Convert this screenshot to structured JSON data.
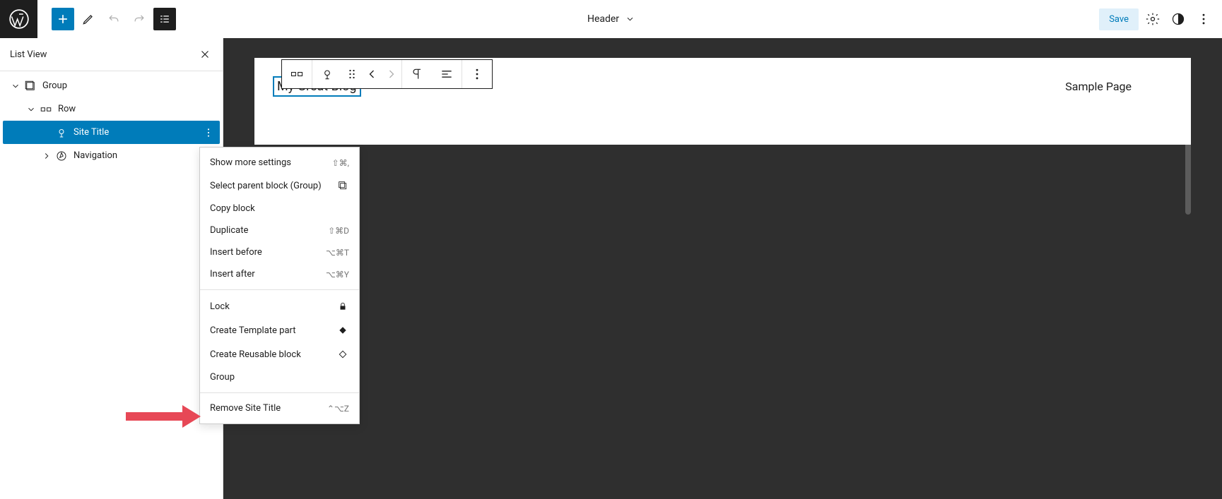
{
  "topbar": {
    "template_label": "Header",
    "save_label": "Save"
  },
  "list_view": {
    "title": "List View",
    "items": [
      {
        "label": "Group",
        "depth": 0,
        "expanded": true,
        "icon": "group"
      },
      {
        "label": "Row",
        "depth": 1,
        "expanded": true,
        "icon": "row"
      },
      {
        "label": "Site Title",
        "depth": 2,
        "selected": true,
        "icon": "site-title"
      },
      {
        "label": "Navigation",
        "depth": 2,
        "collapsed": true,
        "icon": "navigation"
      }
    ]
  },
  "canvas": {
    "site_title": "My Great Blog",
    "nav_item": "Sample Page"
  },
  "context_menu": {
    "sections": [
      [
        {
          "label": "Show more settings",
          "shortcut": "⇧⌘,"
        },
        {
          "label": "Select parent block (Group)",
          "icon": "copy"
        },
        {
          "label": "Copy block"
        },
        {
          "label": "Duplicate",
          "shortcut": "⇧⌘D"
        },
        {
          "label": "Insert before",
          "shortcut": "⌥⌘T"
        },
        {
          "label": "Insert after",
          "shortcut": "⌥⌘Y"
        }
      ],
      [
        {
          "label": "Lock",
          "icon": "lock"
        },
        {
          "label": "Create Template part",
          "icon": "template-part"
        },
        {
          "label": "Create Reusable block",
          "icon": "reusable"
        },
        {
          "label": "Group"
        }
      ],
      [
        {
          "label": "Remove Site Title",
          "shortcut": "⌃⌥Z"
        }
      ]
    ]
  }
}
